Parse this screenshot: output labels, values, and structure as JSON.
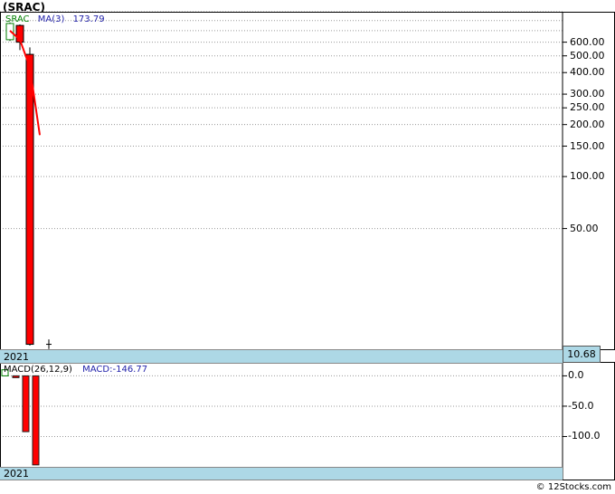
{
  "header": {
    "title": "(SRAC)"
  },
  "footer": {
    "copyright": "© 12Stocks.com"
  },
  "colors": {
    "up": "#008000",
    "down": "#ff0000",
    "ma": "#ff0000",
    "band": "#add8e6",
    "last_price_box": "#add8e6"
  },
  "price_panel": {
    "legend": {
      "symbol": "SRAC",
      "ma_label": "MA(3)",
      "ma_value": "173.79"
    },
    "year_label": "2021",
    "last_price": "10.68",
    "y_ticks": [
      "600.00",
      "500.00",
      "400.00",
      "300.00",
      "250.00",
      "200.00",
      "150.00",
      "100.00",
      "50.00"
    ]
  },
  "macd_panel": {
    "legend": {
      "label": "MACD(26,12,9)",
      "value_label": "MACD:-146.77"
    },
    "year_label": "2021",
    "y_ticks": [
      "0.0",
      "-50.0",
      "-100.0"
    ]
  },
  "chart_data": [
    {
      "type": "candlestick",
      "title": "(SRAC)",
      "y_scale": "log",
      "ylim": [
        10,
        900
      ],
      "grid": true,
      "candles": [
        {
          "index": 0,
          "open": 620,
          "close": 770,
          "high": 780,
          "low": 610,
          "direction": "up"
        },
        {
          "index": 1,
          "open": 750,
          "close": 600,
          "high": 760,
          "low": 540,
          "direction": "down"
        },
        {
          "index": 2,
          "open": 510,
          "close": 10.68,
          "high": 560,
          "low": 10.5,
          "direction": "down"
        },
        {
          "index": 3,
          "open": 10.68,
          "close": 10.68,
          "high": 11.0,
          "low": 10.4,
          "direction": "flat"
        }
      ],
      "ma_series": {
        "name": "MA(3)",
        "values": [
          700,
          620,
          430,
          173.79
        ]
      },
      "last_value": 10.68
    },
    {
      "type": "bar",
      "title": "MACD(26,12,9)",
      "ylim": [
        -150,
        20
      ],
      "grid": true,
      "values": [
        10,
        -2,
        -92,
        -146.77
      ],
      "directions": [
        "up",
        "down",
        "down",
        "down"
      ]
    }
  ]
}
